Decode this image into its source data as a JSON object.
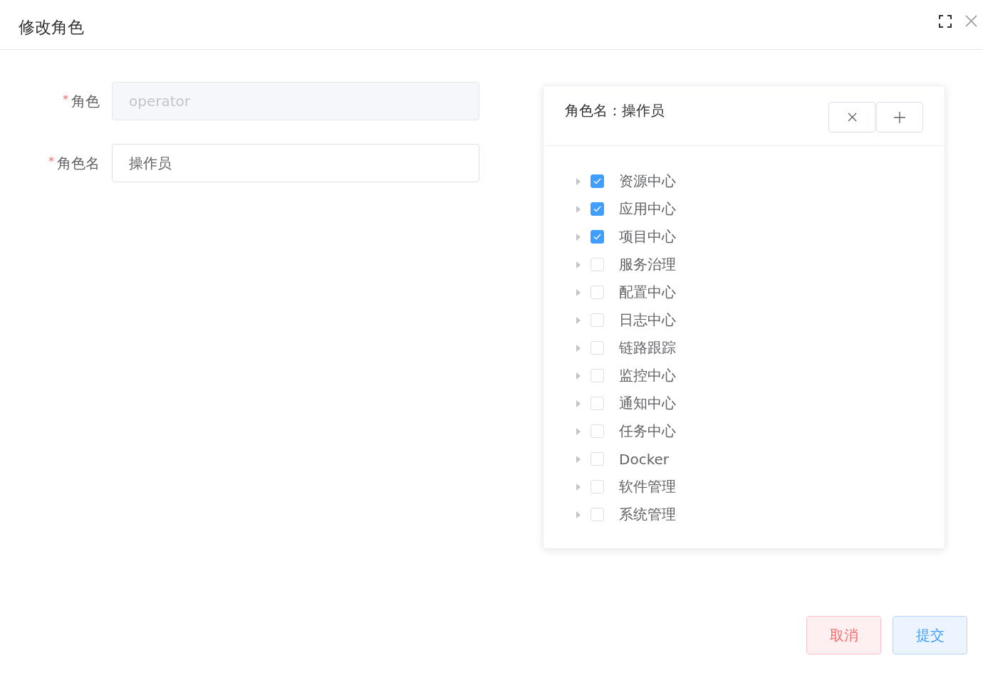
{
  "dialog": {
    "title": "修改角色"
  },
  "form": {
    "fields": [
      {
        "mark": "*",
        "label": "角色",
        "value": "operator",
        "disabled": true
      },
      {
        "mark": "*",
        "label": "角色名",
        "value": "操作员",
        "disabled": false
      }
    ]
  },
  "permission_card": {
    "title": "角色名：操作员",
    "tree": [
      {
        "label": "资源中心",
        "checked": true,
        "expanded": false
      },
      {
        "label": "应用中心",
        "checked": true,
        "expanded": false
      },
      {
        "label": "项目中心",
        "checked": true,
        "expanded": false
      },
      {
        "label": "服务治理",
        "checked": false,
        "expanded": false
      },
      {
        "label": "配置中心",
        "checked": false,
        "expanded": false
      },
      {
        "label": "日志中心",
        "checked": false,
        "expanded": false
      },
      {
        "label": "链路跟踪",
        "checked": false,
        "expanded": false
      },
      {
        "label": "监控中心",
        "checked": false,
        "expanded": false
      },
      {
        "label": "通知中心",
        "checked": false,
        "expanded": false
      },
      {
        "label": "任务中心",
        "checked": false,
        "expanded": false
      },
      {
        "label": "Docker",
        "checked": false,
        "expanded": false
      },
      {
        "label": "软件管理",
        "checked": false,
        "expanded": false
      },
      {
        "label": "系统管理",
        "checked": false,
        "expanded": false
      }
    ]
  },
  "buttons": [
    {
      "label": "取消",
      "kind": "cancel"
    },
    {
      "label": "提交",
      "kind": "submit"
    }
  ]
}
